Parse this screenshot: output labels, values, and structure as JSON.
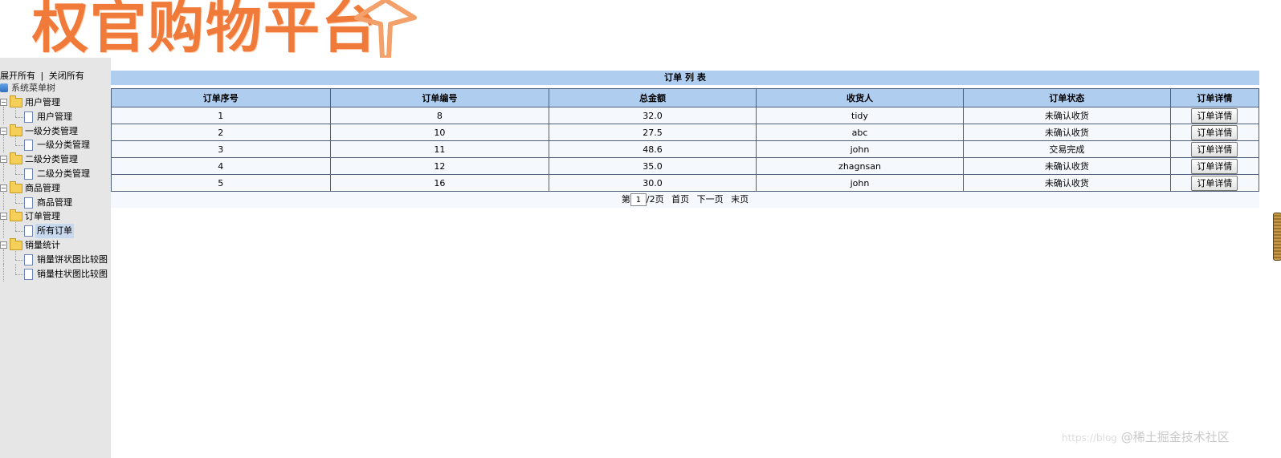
{
  "banner": {
    "logo_text": "权官购物平台"
  },
  "sidebar": {
    "expand_all": "展开所有",
    "separator": "|",
    "collapse_all": "关闭所有",
    "root": "系统菜单树",
    "groups": [
      {
        "label": "用户管理",
        "items": [
          "用户管理"
        ]
      },
      {
        "label": "一级分类管理",
        "items": [
          "一级分类管理"
        ]
      },
      {
        "label": "二级分类管理",
        "items": [
          "二级分类管理"
        ]
      },
      {
        "label": "商品管理",
        "items": [
          "商品管理"
        ]
      },
      {
        "label": "订单管理",
        "items": [
          "所有订单"
        ]
      },
      {
        "label": "销量统计",
        "items": [
          "销量饼状图比较图",
          "销量柱状图比较图"
        ]
      }
    ],
    "selected_item": "所有订单"
  },
  "orders": {
    "title": "订单 列 表",
    "columns": [
      "订单序号",
      "订单编号",
      "总金额",
      "收货人",
      "订单状态",
      "订单详情"
    ],
    "rows": [
      {
        "seq": "1",
        "number": "8",
        "total": "32.0",
        "receiver": "tidy",
        "status": "未确认收货"
      },
      {
        "seq": "2",
        "number": "10",
        "total": "27.5",
        "receiver": "abc",
        "status": "未确认收货"
      },
      {
        "seq": "3",
        "number": "11",
        "total": "48.6",
        "receiver": "john",
        "status": "交易完成"
      },
      {
        "seq": "4",
        "number": "12",
        "total": "35.0",
        "receiver": "zhagnsan",
        "status": "未确认收货"
      },
      {
        "seq": "5",
        "number": "16",
        "total": "30.0",
        "receiver": "john",
        "status": "未确认收货"
      }
    ],
    "detail_button_label": "订单详情"
  },
  "pager": {
    "prefix": "第",
    "current_page": "1",
    "suffix": "/2页",
    "first": "首页",
    "next": "下一页",
    "last": "末页"
  },
  "watermark": {
    "url": "https://blog",
    "text": "@稀土掘金技术社区"
  }
}
